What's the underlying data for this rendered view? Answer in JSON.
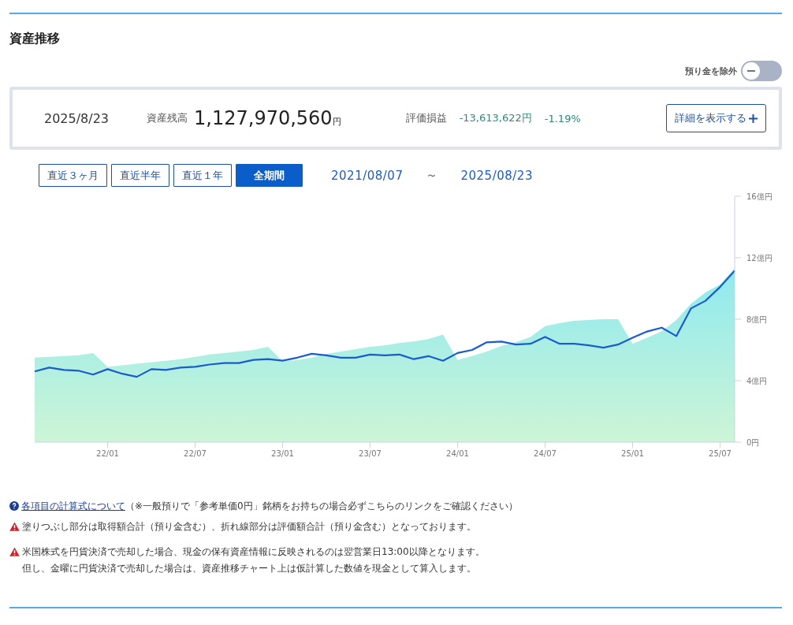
{
  "title": "資産推移",
  "toggle": {
    "label": "預り金を除外",
    "on": false
  },
  "summary": {
    "date": "2025/8/23",
    "balance_label": "資産残高",
    "balance": "1,127,970,560",
    "balance_unit": "円",
    "pnl_label": "評価損益",
    "pnl_amount": "-13,613,622円",
    "pnl_percent": "-1.19%",
    "detail_button": "詳細を表示する"
  },
  "periods": [
    {
      "label": "直近３ヶ月",
      "selected": false
    },
    {
      "label": "直近半年",
      "selected": false
    },
    {
      "label": "直近１年",
      "selected": false
    },
    {
      "label": "全期間",
      "selected": true
    }
  ],
  "range": {
    "from": "2021/08/07",
    "separator": "～",
    "to": "2025/08/23"
  },
  "chart": {
    "chart_data": {
      "type": "area",
      "ylim": [
        0,
        16
      ],
      "categories": [
        null,
        null,
        null,
        null,
        null,
        "22/01",
        null,
        null,
        null,
        null,
        null,
        "22/07",
        null,
        null,
        null,
        null,
        null,
        "23/01",
        null,
        null,
        null,
        null,
        null,
        "23/07",
        null,
        null,
        null,
        null,
        null,
        "24/01",
        null,
        null,
        null,
        null,
        null,
        "24/07",
        null,
        null,
        null,
        null,
        null,
        "25/01",
        null,
        null,
        null,
        null,
        null,
        "25/07",
        null
      ],
      "yticks": [
        {
          "value": 0,
          "label": "0円"
        },
        {
          "value": 4,
          "label": "4億円"
        },
        {
          "value": 8,
          "label": "8億円"
        },
        {
          "value": 12,
          "label": "12億円"
        },
        {
          "value": 16,
          "label": "16億円"
        }
      ],
      "series": [
        {
          "type": "area",
          "color": "#8fe9ef",
          "values": [
            5.5,
            5.55,
            5.6,
            5.65,
            5.8,
            4.9,
            5.0,
            5.1,
            5.2,
            5.3,
            5.4,
            5.55,
            5.7,
            5.8,
            5.9,
            6.0,
            6.2,
            5.25,
            5.35,
            5.5,
            5.75,
            5.9,
            6.05,
            6.2,
            6.3,
            6.45,
            6.55,
            6.7,
            7.0,
            5.35,
            5.6,
            5.9,
            6.25,
            6.5,
            6.85,
            7.55,
            7.75,
            7.9,
            7.95,
            8.0,
            8.0,
            6.4,
            6.8,
            7.2,
            7.95,
            9.0,
            9.75,
            10.25,
            11.3
          ]
        },
        {
          "type": "line",
          "color": "#1a5ccc",
          "values": [
            4.6,
            4.85,
            4.7,
            4.65,
            4.4,
            4.75,
            4.45,
            4.25,
            4.75,
            4.7,
            4.85,
            4.9,
            5.05,
            5.15,
            5.15,
            5.35,
            5.4,
            5.3,
            5.5,
            5.75,
            5.65,
            5.5,
            5.5,
            5.7,
            5.65,
            5.7,
            5.4,
            5.6,
            5.3,
            5.8,
            6.0,
            6.5,
            6.55,
            6.35,
            6.4,
            6.85,
            6.4,
            6.4,
            6.3,
            6.15,
            6.35,
            6.8,
            7.2,
            7.45,
            6.9,
            8.7,
            9.2,
            10.1,
            11.15
          ]
        }
      ]
    }
  },
  "notes": [
    {
      "kind": "help",
      "link": "各項目の計算式について",
      "text": "（※一般預りで「参考単価0円」銘柄をお持ちの場合必ずこちらのリンクをご確認ください）"
    },
    {
      "kind": "warning",
      "lines": [
        "塗りつぶし部分は取得額合計（預り金含む）、折れ線部分は評価額合計（預り金含む）となっております。"
      ]
    },
    {
      "kind": "warning",
      "lines": [
        "米国株式を円貨決済で売却した場合、現金の保有資産情報に反映されるのは翌営業日13:00以降となります。",
        "但し、金曜に円貨決済で売却した場合は、資産推移チャート上は仮計算した数値を現金として算入します。"
      ]
    }
  ]
}
